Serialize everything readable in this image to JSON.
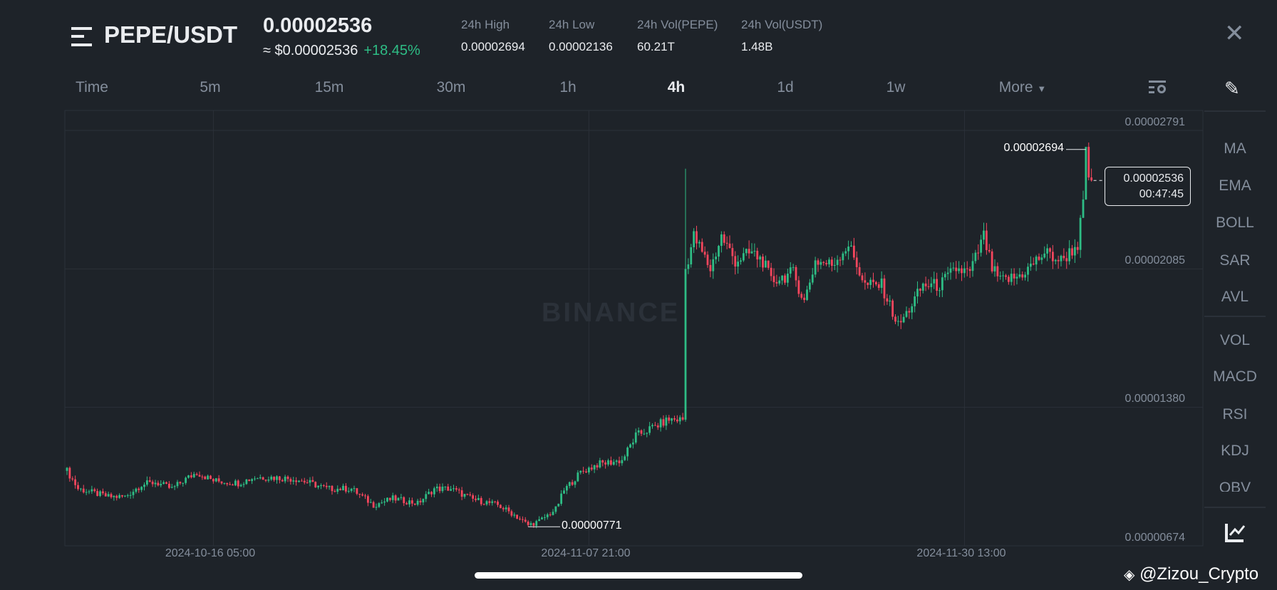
{
  "header": {
    "pair": "PEPE/USDT",
    "price": "0.00002536",
    "usd_price": "≈ $0.00002536",
    "change": "+18.45%",
    "stats": [
      {
        "label": "24h High",
        "value": "0.00002694"
      },
      {
        "label": "24h Low",
        "value": "0.00002136"
      },
      {
        "label": "24h Vol(PEPE)",
        "value": "60.21T"
      },
      {
        "label": "24h Vol(USDT)",
        "value": "1.48B"
      }
    ]
  },
  "tabs": [
    "Time",
    "5m",
    "15m",
    "30m",
    "1h",
    "4h",
    "1d",
    "1w",
    "More"
  ],
  "active_tab": "4h",
  "indicators_main": [
    "MA",
    "EMA",
    "BOLL",
    "SAR",
    "AVL"
  ],
  "indicators_sub": [
    "VOL",
    "MACD",
    "RSI",
    "KDJ",
    "OBV"
  ],
  "watermark": "BINANCE",
  "credit": "@Zizou_Crypto",
  "colors": {
    "up": "#2ebd85",
    "down": "#f6465d",
    "bg": "#1e2329"
  },
  "chart_data": {
    "type": "candlestick",
    "interval": "4h",
    "price_unit": "1e-8 USDT",
    "y_ticks": [
      "0.00002791",
      "0.00002085",
      "0.00001380",
      "0.00000674"
    ],
    "y_tick_values": [
      2791,
      2085,
      1380,
      674
    ],
    "ylim": [
      674,
      2791
    ],
    "x_ticks": [
      "2024-10-16 05:00",
      "2024-11-07 21:00",
      "2024-11-30 13:00"
    ],
    "x_tick_candle_index": [
      53,
      189,
      325
    ],
    "candle_count": 372,
    "close_keypoints": [
      [
        0,
        1056
      ],
      [
        4,
        965
      ],
      [
        15,
        924
      ],
      [
        21,
        924
      ],
      [
        27,
        986
      ],
      [
        32,
        998
      ],
      [
        38,
        965
      ],
      [
        43,
        1014
      ],
      [
        47,
        1048
      ],
      [
        53,
        1006
      ],
      [
        62,
        994
      ],
      [
        68,
        1023
      ],
      [
        74,
        1023
      ],
      [
        83,
        1014
      ],
      [
        88,
        994
      ],
      [
        94,
        965
      ],
      [
        103,
        965
      ],
      [
        111,
        882
      ],
      [
        118,
        915
      ],
      [
        127,
        890
      ],
      [
        133,
        965
      ],
      [
        139,
        965
      ],
      [
        147,
        911
      ],
      [
        156,
        882
      ],
      [
        162,
        832
      ],
      [
        167,
        780
      ],
      [
        171,
        799
      ],
      [
        177,
        861
      ],
      [
        180,
        957
      ],
      [
        186,
        1048
      ],
      [
        192,
        1089
      ],
      [
        201,
        1110
      ],
      [
        206,
        1235
      ],
      [
        212,
        1276
      ],
      [
        218,
        1318
      ],
      [
        223,
        1318
      ],
      [
        224,
        2085
      ],
      [
        227,
        2251
      ],
      [
        233,
        2085
      ],
      [
        237,
        2251
      ],
      [
        242,
        2126
      ],
      [
        248,
        2168
      ],
      [
        252,
        2126
      ],
      [
        255,
        2023
      ],
      [
        263,
        2064
      ],
      [
        267,
        1919
      ],
      [
        271,
        2126
      ],
      [
        277,
        2106
      ],
      [
        283,
        2210
      ],
      [
        289,
        2002
      ],
      [
        295,
        2002
      ],
      [
        301,
        1795
      ],
      [
        304,
        1857
      ],
      [
        310,
        2002
      ],
      [
        316,
        2002
      ],
      [
        322,
        2085
      ],
      [
        327,
        2064
      ],
      [
        332,
        2251
      ],
      [
        335,
        2085
      ],
      [
        338,
        2023
      ],
      [
        344,
        2043
      ],
      [
        348,
        2085
      ],
      [
        354,
        2168
      ],
      [
        360,
        2126
      ],
      [
        366,
        2210
      ],
      [
        368,
        2417
      ],
      [
        369,
        2666
      ],
      [
        370,
        2562
      ],
      [
        371,
        2536
      ]
    ],
    "high_marker": {
      "label": "0.00002694",
      "value": 2694
    },
    "low_marker": {
      "label": "0.00000771",
      "value": 771
    },
    "last_price": {
      "label": "0.00002536",
      "countdown": "00:47:45",
      "value": 2536
    }
  }
}
